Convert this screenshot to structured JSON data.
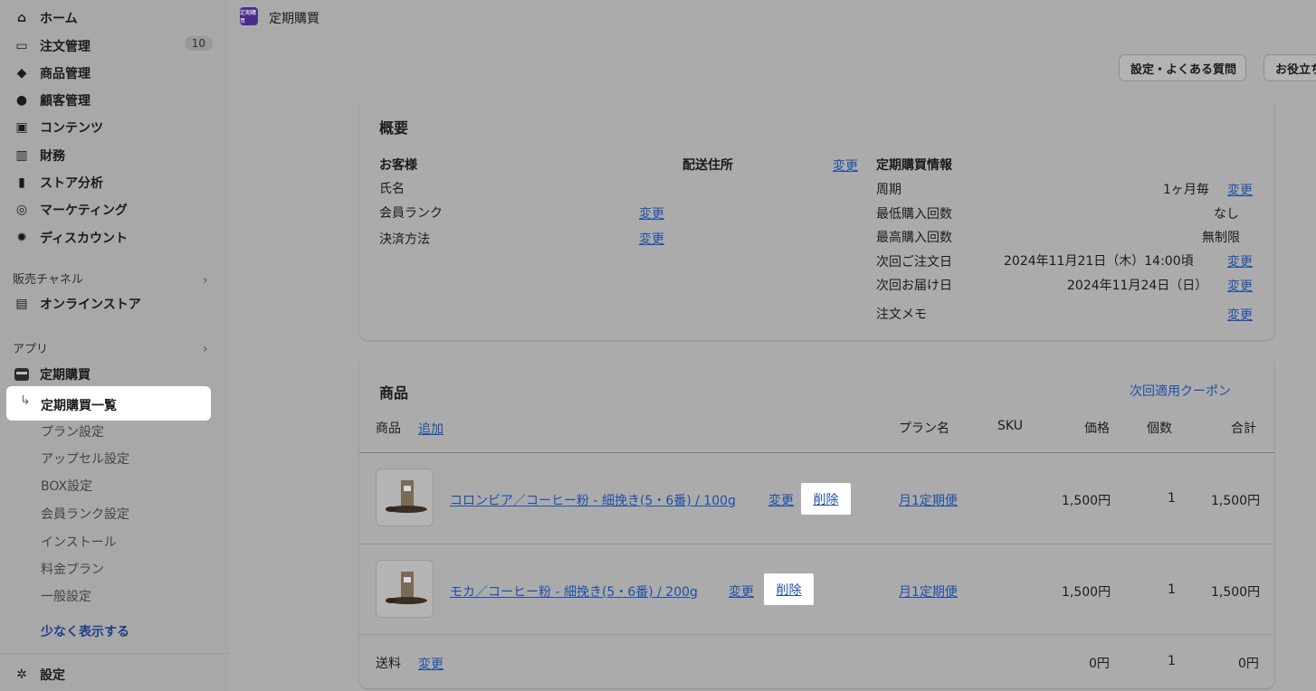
{
  "sidebar": {
    "nav": [
      {
        "label": "ホーム",
        "icon": "home-icon",
        "glyph": "⌂"
      },
      {
        "label": "注文管理",
        "icon": "inbox-icon",
        "glyph": "▭",
        "badge": "10"
      },
      {
        "label": "商品管理",
        "icon": "tag-icon",
        "glyph": "◆"
      },
      {
        "label": "顧客管理",
        "icon": "person-icon",
        "glyph": "●"
      },
      {
        "label": "コンテンツ",
        "icon": "content-icon",
        "glyph": "▣"
      },
      {
        "label": "財務",
        "icon": "bank-icon",
        "glyph": "▥"
      },
      {
        "label": "ストア分析",
        "icon": "chart-icon",
        "glyph": "▮"
      },
      {
        "label": "マーケティング",
        "icon": "target-icon",
        "glyph": "◎"
      },
      {
        "label": "ディスカウント",
        "icon": "discount-icon",
        "glyph": "✹"
      }
    ],
    "sales_channel_label": "販売チャネル",
    "online_store": {
      "label": "オンラインストア",
      "icon": "store-icon",
      "glyph": "▤"
    },
    "apps_label": "アプリ",
    "app": {
      "label": "定期購買",
      "icon": "app-logo-icon"
    },
    "active_sub": "定期購買一覧",
    "sub_items": [
      "プラン設定",
      "アップセル設定",
      "BOX設定",
      "会員ランク設定",
      "インストール",
      "料金プラン",
      "一般設定"
    ],
    "show_less": "少なく表示する",
    "settings": {
      "label": "設定",
      "icon": "gear-icon",
      "glyph": "✲"
    }
  },
  "header": {
    "app_logo_text": "定期購買",
    "title": "定期購買",
    "buttons": [
      "設定・よくある質問",
      "お役立ち"
    ]
  },
  "overview": {
    "title": "概要",
    "customer_heading": "お客様",
    "name_label": "氏名",
    "rank_label": "会員ランク",
    "payment_label": "決済方法",
    "change": "変更",
    "address_heading": "配送住所",
    "sub_heading": "定期購買情報",
    "rows": [
      {
        "label": "周期",
        "value": "1ヶ月毎",
        "change": "変更"
      },
      {
        "label": "最低購入回数",
        "value": "なし",
        "change": ""
      },
      {
        "label": "最高購入回数",
        "value": "無制限",
        "change": ""
      },
      {
        "label": "次回ご注文日",
        "value": "2024年11月21日（木）14:00頃",
        "change": "変更"
      },
      {
        "label": "次回お届け日",
        "value": "2024年11月24日（日）",
        "change": "変更"
      },
      {
        "label": "注文メモ",
        "value": "",
        "change": "変更"
      }
    ]
  },
  "products": {
    "title": "商品",
    "coupon_link": "次回適用クーポン",
    "columns": {
      "product": "商品",
      "add": "追加",
      "plan": "プラン名",
      "sku": "SKU",
      "price": "価格",
      "qty": "個数",
      "total": "合計"
    },
    "items": [
      {
        "name": "コロンビア／コーヒー粉 - 細挽き(5・6番) / 100g",
        "change": "変更",
        "delete": "削除",
        "plan": "月1定期便",
        "sku": "",
        "price": "1,500円",
        "qty": "1",
        "total": "1,500円"
      },
      {
        "name": "モカ／コーヒー粉 - 細挽き(5・6番) / 200g",
        "change": "変更",
        "delete": "削除",
        "plan": "月1定期便",
        "sku": "",
        "price": "1,500円",
        "qty": "1",
        "total": "1,500円"
      }
    ],
    "shipping": {
      "label": "送料",
      "change": "変更",
      "price": "0円",
      "qty": "1",
      "total": "0円"
    }
  }
}
